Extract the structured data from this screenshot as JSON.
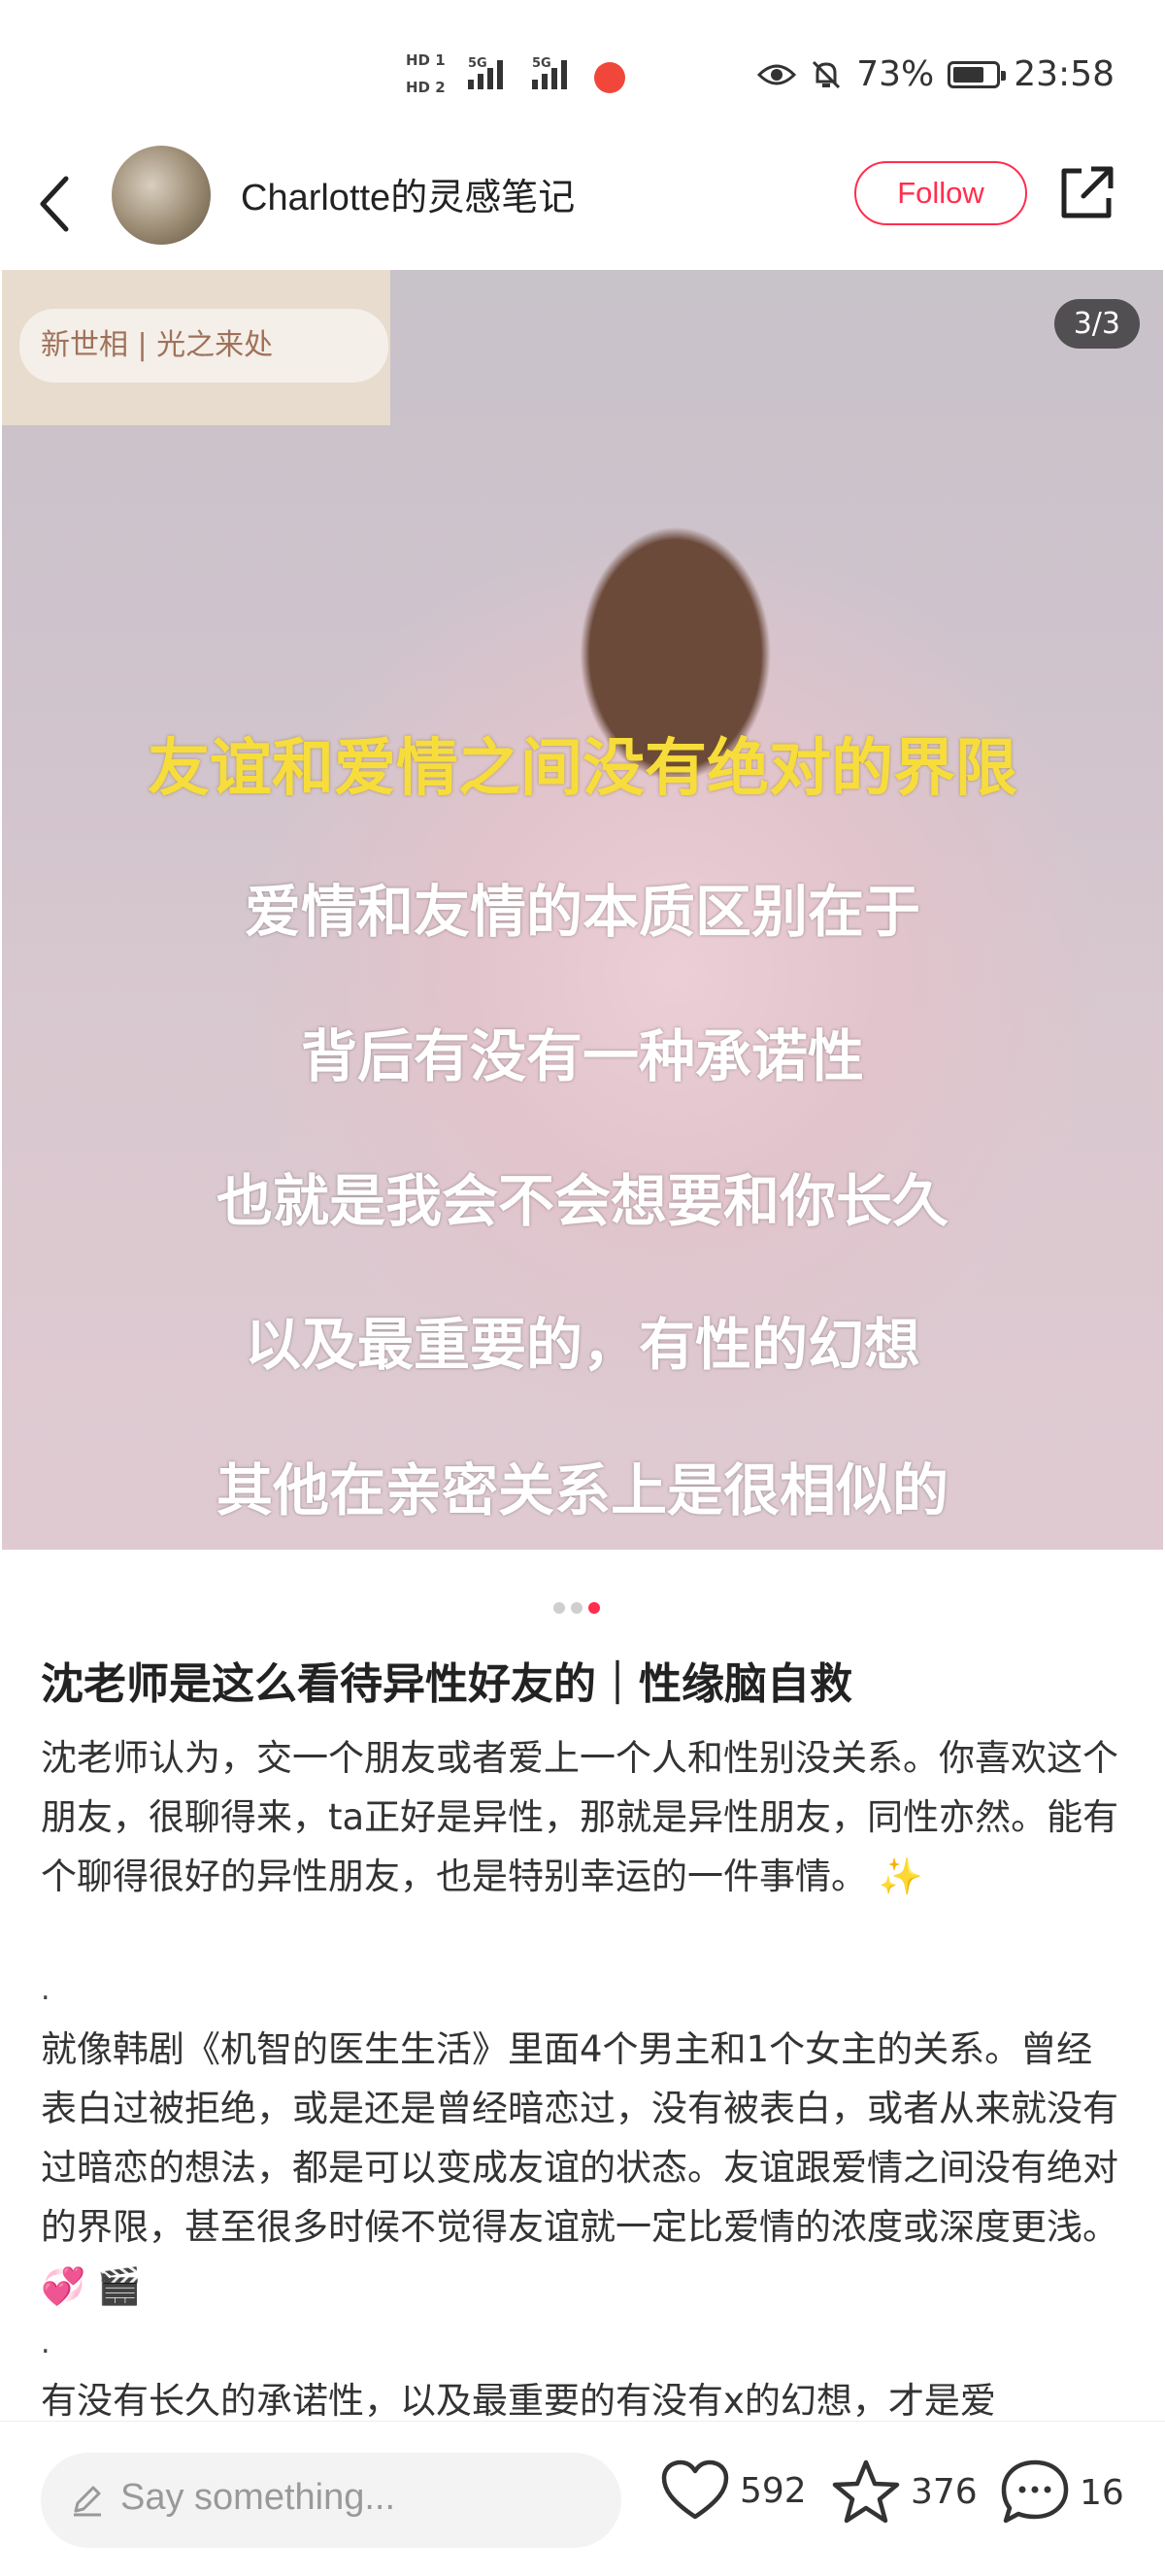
{
  "status_bar": {
    "hd1": "HD 1",
    "hd2": "HD 2",
    "net1": "5G",
    "net2": "5G",
    "battery_percent": "73%",
    "battery_level": 0.73,
    "time": "23:58"
  },
  "nav": {
    "author": "Charlotte的灵感笔记",
    "follow_label": "Follow"
  },
  "media": {
    "counter": "3/3",
    "shelf_text": "新世相 | 光之来处",
    "subtitles": [
      "友谊和爱情之间没有绝对的界限",
      "爱情和友情的本质区别在于",
      "背后有没有一种承诺性",
      "也就是我会不会想要和你长久",
      "以及最重要的，有性的幻想",
      "其他在亲密关系上是很相似的"
    ],
    "page_index": 3,
    "page_total": 3
  },
  "post": {
    "title": "沈老师是这么看待异性好友的｜性缘脑自救",
    "paragraphs": [
      "沈老师认为，交一个朋友或者爱上一个人和性别没关系。你喜欢这个朋友，很聊得来，ta正好是异性，那就是异性朋友，同性亦然。能有个聊得很好的异性朋友，也是特别幸运的一件事情。 ✨",
      "就像韩剧《机智的医生生活》里面4个男主和1个女主的关系。曾经表白过被拒绝，或是还是曾经暗恋过，没有被表白，或者从来就没有过暗恋的想法，都是可以变成友谊的状态。友谊跟爱情之间没有绝对的界限，甚至很多时候不觉得友谊就一定比爱情的浓度或深度更浅。💞 🎬",
      "有没有长久的承诺性，以及最重要的有没有x的幻想，才是爱"
    ],
    "separator": "."
  },
  "bottom_bar": {
    "comment_placeholder": "Say something...",
    "likes": "592",
    "stars": "376",
    "comments": "16"
  },
  "colors": {
    "accent": "#ff2e4d",
    "subtitle_yellow": "#f7dd3b"
  }
}
